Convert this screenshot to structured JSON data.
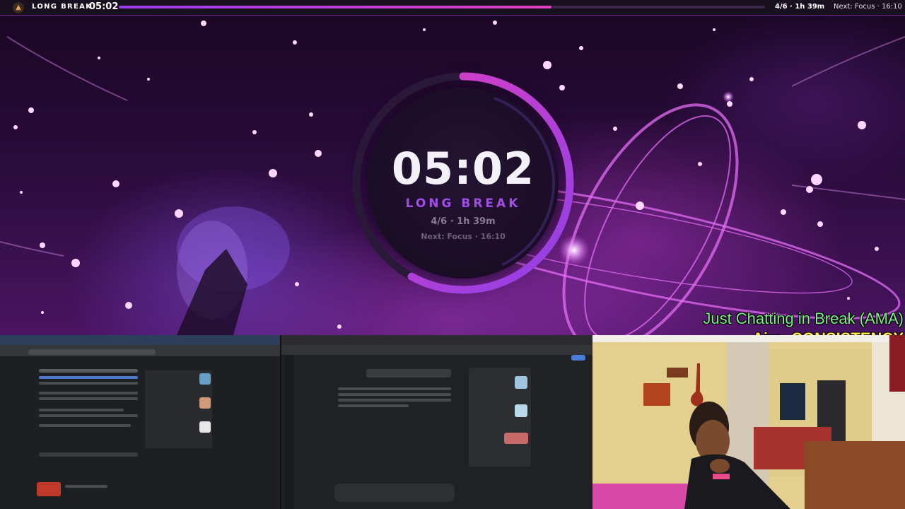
{
  "topbar": {
    "mode_icon": "bell-icon",
    "mode_label": "LONG BREAK",
    "time": "05:02",
    "progress": 0.67,
    "session": "4/6 · 1h 39m",
    "next": "Next: Focus · 16:10"
  },
  "timer": {
    "time": "05:02",
    "mode": "LONG BREAK",
    "session": "4/6 · 1h 39m",
    "next": "Next: Focus · 16:10",
    "ring_progress": 0.58
  },
  "overlay": {
    "line1": "Just Chatting in Break (AMA)",
    "line2": "Aim: CONSISTENCY"
  },
  "colors": {
    "accent": "#a34de8",
    "ring_gradient_start": "#8f3fe8",
    "ring_gradient_end": "#e13fbf",
    "caption_green": "#7ef08a",
    "caption_yellow": "#ffe84a"
  }
}
